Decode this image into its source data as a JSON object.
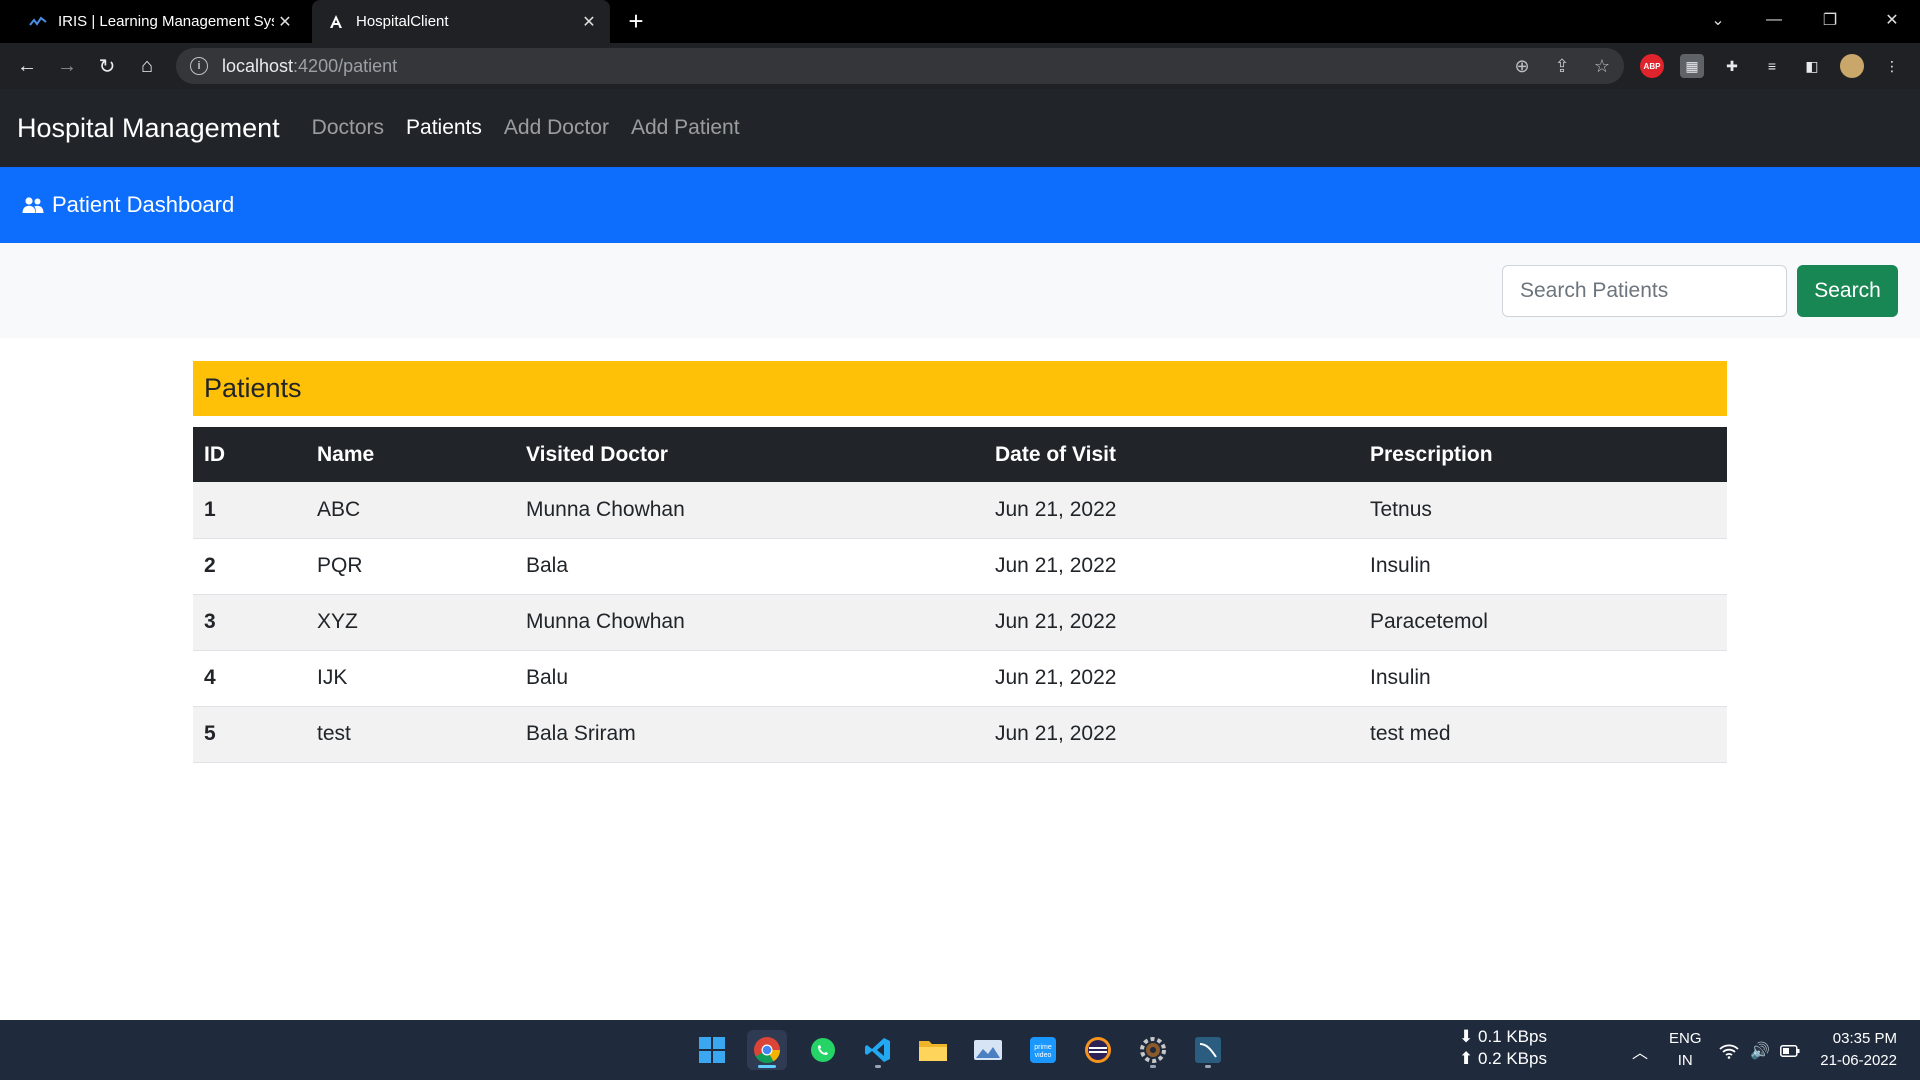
{
  "browser": {
    "tabs": [
      {
        "title": "IRIS | Learning Management Syst",
        "active": false
      },
      {
        "title": "HospitalClient",
        "active": true
      }
    ],
    "url_host": "localhost",
    "url_path": ":4200/patient"
  },
  "app": {
    "brand": "Hospital Management",
    "nav": [
      {
        "label": "Doctors",
        "active": false
      },
      {
        "label": "Patients",
        "active": true
      },
      {
        "label": "Add Doctor",
        "active": false
      },
      {
        "label": "Add Patient",
        "active": false
      }
    ],
    "dashboard_title": "Patient Dashboard",
    "search": {
      "placeholder": "Search Patients",
      "value": "",
      "button_label": "Search"
    },
    "card_title": "Patients",
    "table": {
      "headers": [
        "ID",
        "Name",
        "Visited Doctor",
        "Date of Visit",
        "Prescription"
      ],
      "rows": [
        [
          "1",
          "ABC",
          "Munna Chowhan",
          "Jun 21, 2022",
          "Tetnus"
        ],
        [
          "2",
          "PQR",
          "Bala",
          "Jun 21, 2022",
          "Insulin"
        ],
        [
          "3",
          "XYZ",
          "Munna Chowhan",
          "Jun 21, 2022",
          "Paracetemol"
        ],
        [
          "4",
          "IJK",
          "Balu",
          "Jun 21, 2022",
          "Insulin"
        ],
        [
          "5",
          "test",
          "Bala Sriram",
          "Jun 21, 2022",
          "test med"
        ]
      ]
    }
  },
  "taskbar": {
    "net_down": "0.1 KBps",
    "net_up": "0.2 KBps",
    "lang_1": "ENG",
    "lang_2": "IN",
    "time": "03:35 PM",
    "date": "21-06-2022"
  },
  "colors": {
    "navbar": "#212529",
    "dashboard_bar": "#0d6efd",
    "search_button": "#198754",
    "card_header": "#ffc107"
  }
}
